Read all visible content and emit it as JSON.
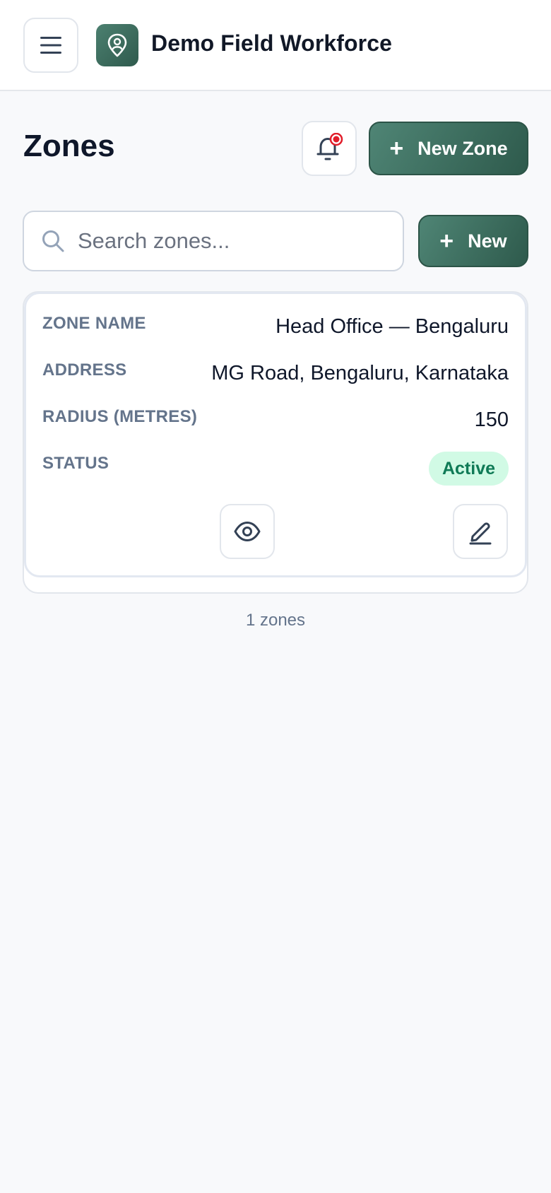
{
  "app": {
    "title": "Demo Field Workforce"
  },
  "icons": {
    "menu": "hamburger-menu-icon",
    "logo": "location-pin-icon",
    "bell": "bell-icon",
    "search": "search-icon",
    "view": "eye-icon",
    "edit": "pencil-icon"
  },
  "colors": {
    "accent": "#3d6e60",
    "notification_dot": "#e11d2a",
    "status_active_bg": "#d1fae5",
    "status_active_text": "#0f7a56"
  },
  "header": {
    "page_title": "Zones",
    "new_zone_label": "New Zone",
    "new_zone_icon": "+"
  },
  "search": {
    "placeholder": "Search zones...",
    "value": "",
    "new_label": "New",
    "new_icon": "+"
  },
  "zone": {
    "fields": {
      "name_label": "ZONE NAME",
      "name_value": "Head Office — Bengaluru",
      "address_label": "ADDRESS",
      "address_value": "MG Road, Bengaluru, Karnataka",
      "radius_label": "RADIUS (METRES)",
      "radius_value": "150",
      "status_label": "STATUS",
      "status_value": "Active"
    }
  },
  "footer": {
    "count_text": "1 zones"
  }
}
